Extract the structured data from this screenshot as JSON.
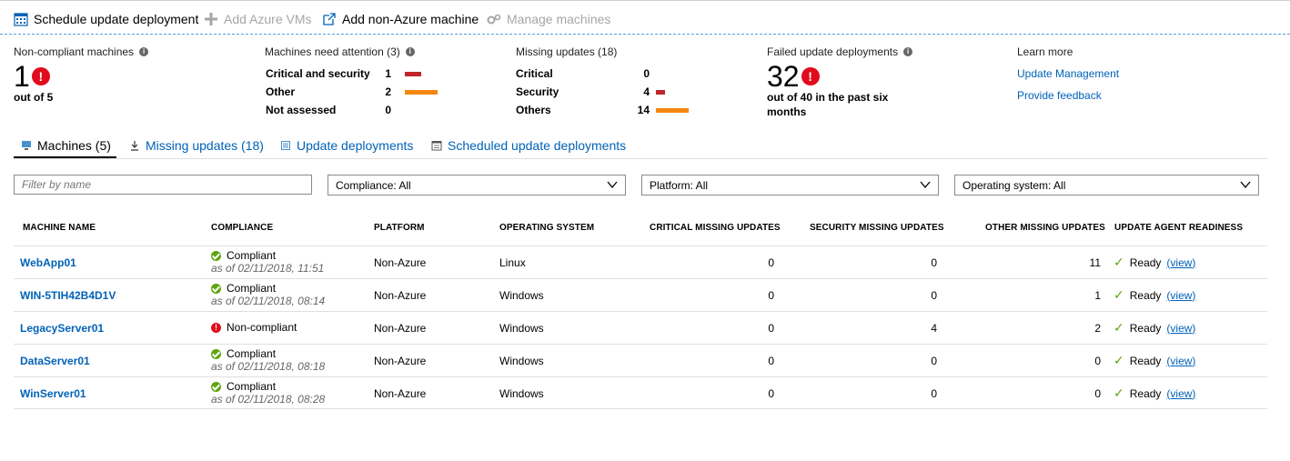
{
  "toolbar": {
    "schedule": "Schedule update deployment",
    "add_azure": "Add Azure VMs",
    "add_non_azure": "Add non-Azure machine",
    "manage": "Manage machines"
  },
  "summary": {
    "noncompliant": {
      "title": "Non-compliant machines",
      "value": "1",
      "sub": "out of 5"
    },
    "attention": {
      "title": "Machines need attention (3)",
      "rows": [
        {
          "label": "Critical and security",
          "value": "1",
          "bar_fraction": 0.5,
          "color": "#c0252a"
        },
        {
          "label": "Other",
          "value": "2",
          "bar_fraction": 1.0,
          "color": "#f5870f"
        },
        {
          "label": "Not assessed",
          "value": "0",
          "bar_fraction": 0,
          "color": "#cccccc"
        }
      ]
    },
    "missing": {
      "title": "Missing updates (18)",
      "rows": [
        {
          "label": "Critical",
          "value": "0",
          "bar_fraction": 0,
          "color": "#c0252a"
        },
        {
          "label": "Security",
          "value": "4",
          "bar_fraction": 0.29,
          "color": "#c0252a"
        },
        {
          "label": "Others",
          "value": "14",
          "bar_fraction": 1.0,
          "color": "#f5870f"
        }
      ]
    },
    "failed": {
      "title": "Failed update deployments",
      "value": "32",
      "sub": "out of 40 in the past six months"
    },
    "learn": {
      "title": "Learn more",
      "link1": "Update Management",
      "link2": "Provide feedback"
    }
  },
  "tabs": {
    "machines": "Machines (5)",
    "missing": "Missing updates (18)",
    "deployments": "Update deployments",
    "scheduled": "Scheduled update deployments"
  },
  "filters": {
    "name_placeholder": "Filter by name",
    "compliance": "Compliance: All",
    "platform": "Platform: All",
    "os": "Operating system: All"
  },
  "table": {
    "headers": {
      "name": "MACHINE NAME",
      "compliance": "COMPLIANCE",
      "platform": "PLATFORM",
      "os": "OPERATING SYSTEM",
      "critical": "CRITICAL MISSING UPDATES",
      "security": "SECURITY MISSING UPDATES",
      "other": "OTHER MISSING UPDATES",
      "agent": "UPDATE AGENT READINESS"
    },
    "rows": [
      {
        "name": "WebApp01",
        "compliance": "Compliant",
        "status": "ok",
        "asof": "as of 02/11/2018, 11:51",
        "platform": "Non-Azure",
        "os": "Linux",
        "critical": "0",
        "security": "0",
        "other": "11",
        "agent": "Ready",
        "view": "(view)"
      },
      {
        "name": "WIN-5TIH42B4D1V",
        "compliance": "Compliant",
        "status": "ok",
        "asof": "as of 02/11/2018, 08:14",
        "platform": "Non-Azure",
        "os": "Windows",
        "critical": "0",
        "security": "0",
        "other": "1",
        "agent": "Ready",
        "view": "(view)"
      },
      {
        "name": "LegacyServer01",
        "compliance": "Non-compliant",
        "status": "bad",
        "asof": "",
        "platform": "Non-Azure",
        "os": "Windows",
        "critical": "0",
        "security": "4",
        "other": "2",
        "agent": "Ready",
        "view": "(view)"
      },
      {
        "name": "DataServer01",
        "compliance": "Compliant",
        "status": "ok",
        "asof": "as of 02/11/2018, 08:18",
        "platform": "Non-Azure",
        "os": "Windows",
        "critical": "0",
        "security": "0",
        "other": "0",
        "agent": "Ready",
        "view": "(view)"
      },
      {
        "name": "WinServer01",
        "compliance": "Compliant",
        "status": "ok",
        "asof": "as of 02/11/2018, 08:28",
        "platform": "Non-Azure",
        "os": "Windows",
        "critical": "0",
        "security": "0",
        "other": "0",
        "agent": "Ready",
        "view": "(view)"
      }
    ]
  }
}
